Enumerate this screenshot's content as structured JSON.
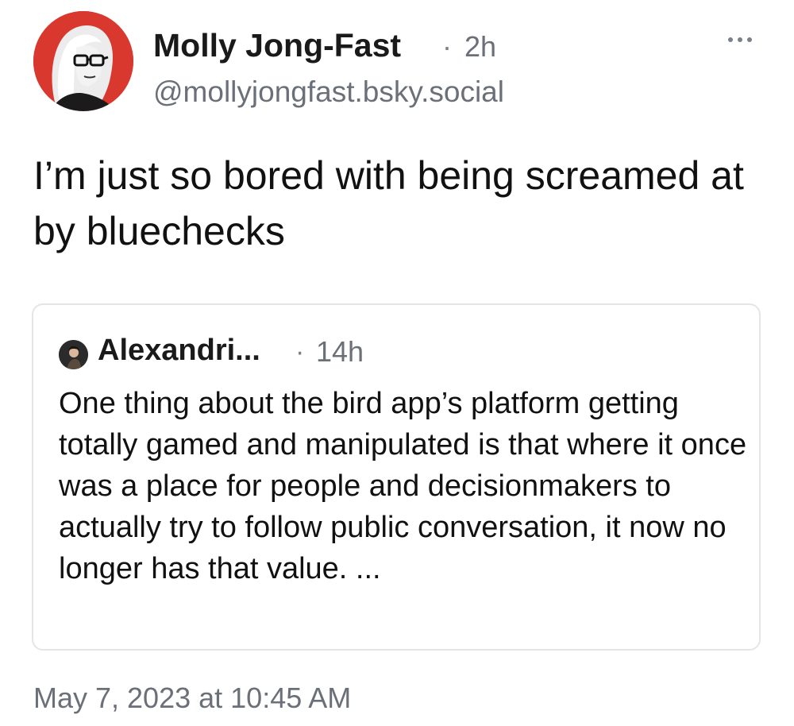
{
  "post": {
    "author": {
      "display_name": "Molly Jong-Fast",
      "handle": "@mollyjongfast.bsky.social",
      "avatar_icon": "user-avatar"
    },
    "separator": "·",
    "age": "2h",
    "text": "I’m just so bored with being screamed at by bluechecks",
    "timestamp": "May 7, 2023 at 10:45 AM"
  },
  "quote": {
    "author_name": "Alexandri...",
    "separator": "·",
    "age": "14h",
    "text": "One thing about the bird app’s platform getting totally gamed and manipulated is that where it once was a place for people and decisionmakers to actually try to follow public conversation, it now no longer has that value. ..."
  },
  "menu": {
    "icon": "more-options-icon"
  },
  "colors": {
    "avatar_bg": "#d9382e",
    "muted_text": "#6b7078",
    "card_border": "#e3e5e8",
    "primary_text": "#111111"
  }
}
